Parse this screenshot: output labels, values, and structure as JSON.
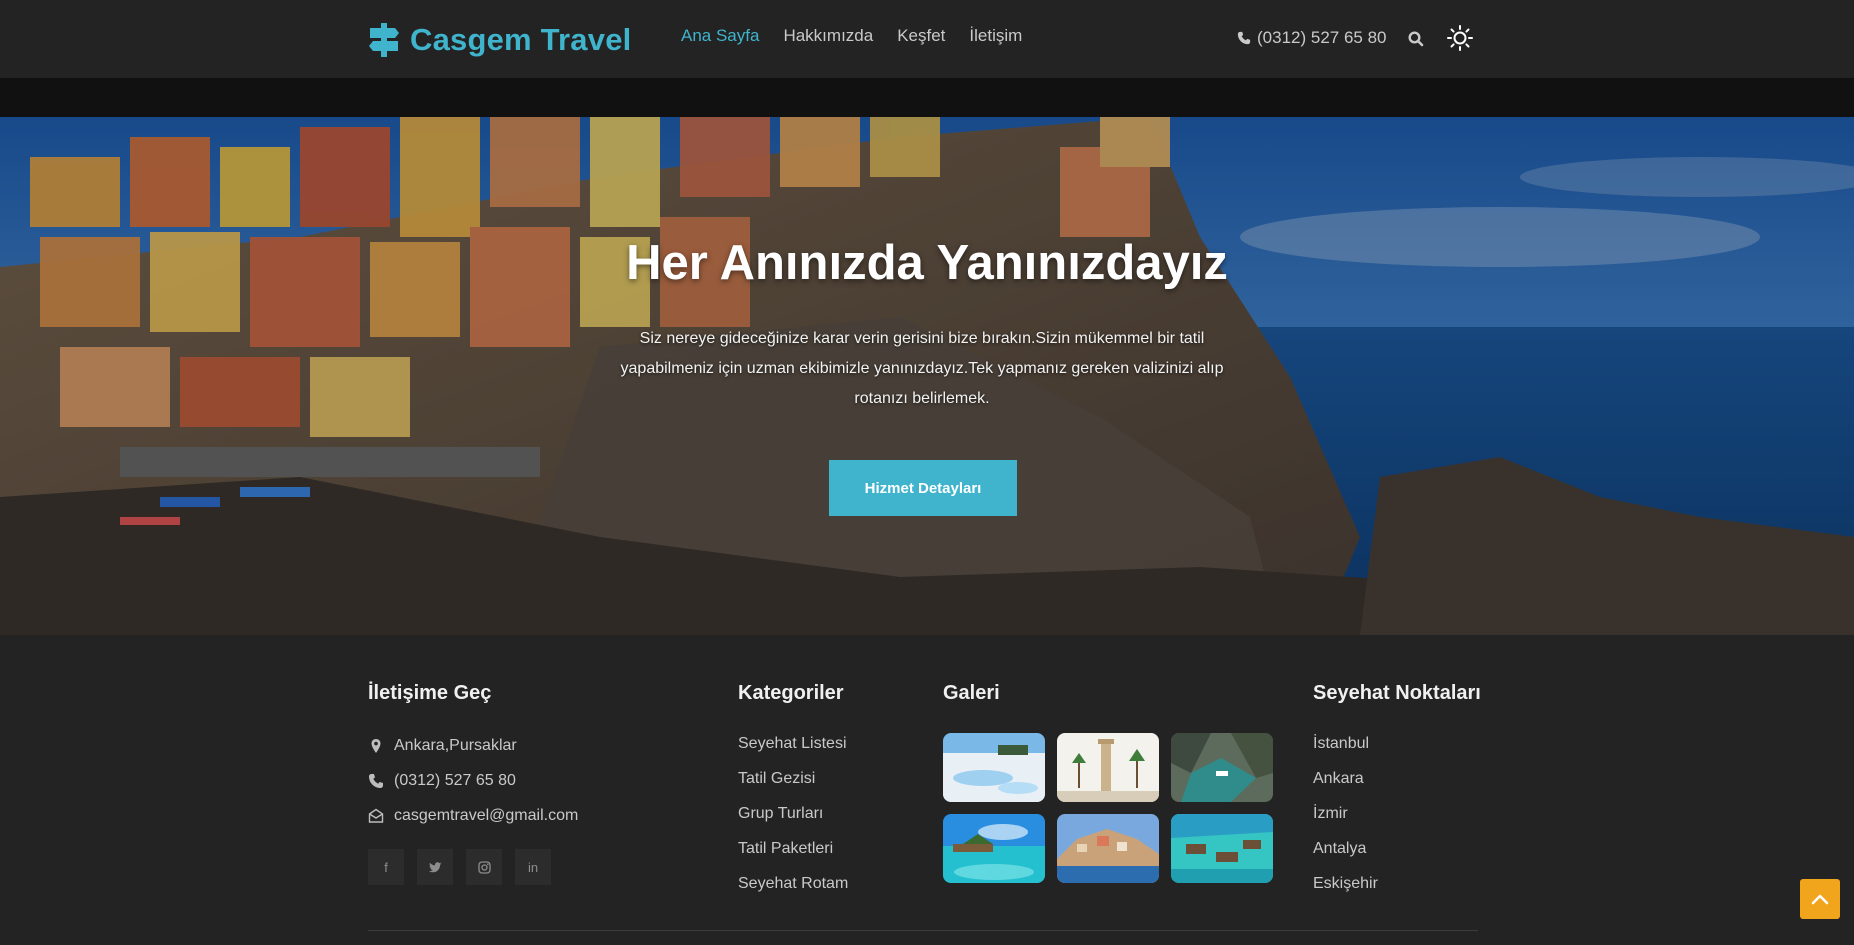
{
  "header": {
    "brand": "Casgem Travel",
    "nav": [
      {
        "label": "Ana Sayfa",
        "active": true
      },
      {
        "label": "Hakkımızda",
        "active": false
      },
      {
        "label": "Keşfet",
        "active": false
      },
      {
        "label": "İletişim",
        "active": false
      }
    ],
    "phone": "(0312) 527 65 80"
  },
  "hero": {
    "title": "Her Anınızda Yanınızdayız",
    "text": "Siz nereye gideceğinize karar verin gerisini bize bırakın.Sizin mükemmel bir tatil yapabilmeniz için uzman ekibimizle yanınızdayız.Tek yapmanız gereken valizinizi alıp rotanızı belirlemek.",
    "button": "Hizmet Detayları"
  },
  "footer": {
    "contact": {
      "title": "İletişime Geç",
      "address": "Ankara,Pursaklar",
      "phone": "(0312) 527 65 80",
      "email": "casgemtravel@gmail.com"
    },
    "categories": {
      "title": "Kategoriler",
      "items": [
        "Seyehat Listesi",
        "Tatil Gezisi",
        "Grup Turları",
        "Tatil Paketleri",
        "Seyehat Rotam"
      ]
    },
    "gallery": {
      "title": "Galeri"
    },
    "destinations": {
      "title": "Seyehat Noktaları",
      "items": [
        "İstanbul",
        "Ankara",
        "İzmir",
        "Antalya",
        "Eskişehir"
      ]
    }
  },
  "colors": {
    "accent": "#3fb4cc",
    "background": "#212121",
    "back_to_top": "#f0a51c"
  },
  "icons": {
    "brand": "signpost-icon",
    "phone": "phone-icon",
    "search": "search-icon",
    "theme": "sun-icon",
    "address": "map-marker-icon",
    "email": "envelope-icon",
    "social": [
      "facebook-icon",
      "twitter-icon",
      "instagram-icon",
      "linkedin-icon"
    ],
    "back_to_top": "chevron-up-icon"
  }
}
